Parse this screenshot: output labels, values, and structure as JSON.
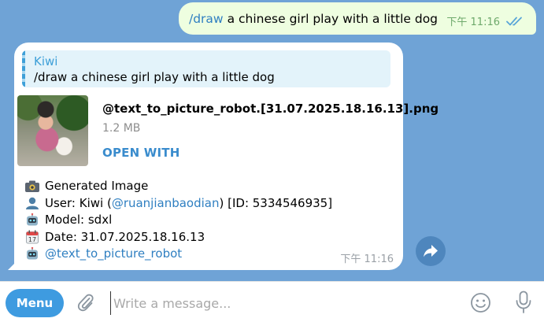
{
  "outgoing": {
    "command": "/draw",
    "text": "a chinese girl play with a little dog",
    "time": "下午 11:16",
    "status_icon": "double-check-icon"
  },
  "incoming": {
    "reply": {
      "name": "Kiwi",
      "text": "/draw a chinese girl play with a little dog"
    },
    "file": {
      "name": "@text_to_picture_robot.[31.07.2025.18.16.13].png",
      "size": "1.2 MB",
      "action": "OPEN WITH"
    },
    "info": {
      "generated": "Generated Image",
      "user_prefix": "User: Kiwi (",
      "user_handle": "@ruanjianbaodian",
      "user_suffix": ") [ID: 5334546935]",
      "model": "Model: sdxl",
      "date": "Date: 31.07.2025.18.16.13",
      "bot_handle": "@text_to_picture_robot"
    },
    "time": "下午 11:16"
  },
  "composer": {
    "menu_label": "Menu",
    "placeholder": "Write a message..."
  },
  "icons": {
    "camera": "camera-icon",
    "user": "user-icon",
    "robot": "robot-icon",
    "calendar": "calendar-icon",
    "share": "share-icon",
    "attach": "paperclip-icon",
    "emoji": "emoji-icon",
    "mic": "microphone-icon"
  }
}
